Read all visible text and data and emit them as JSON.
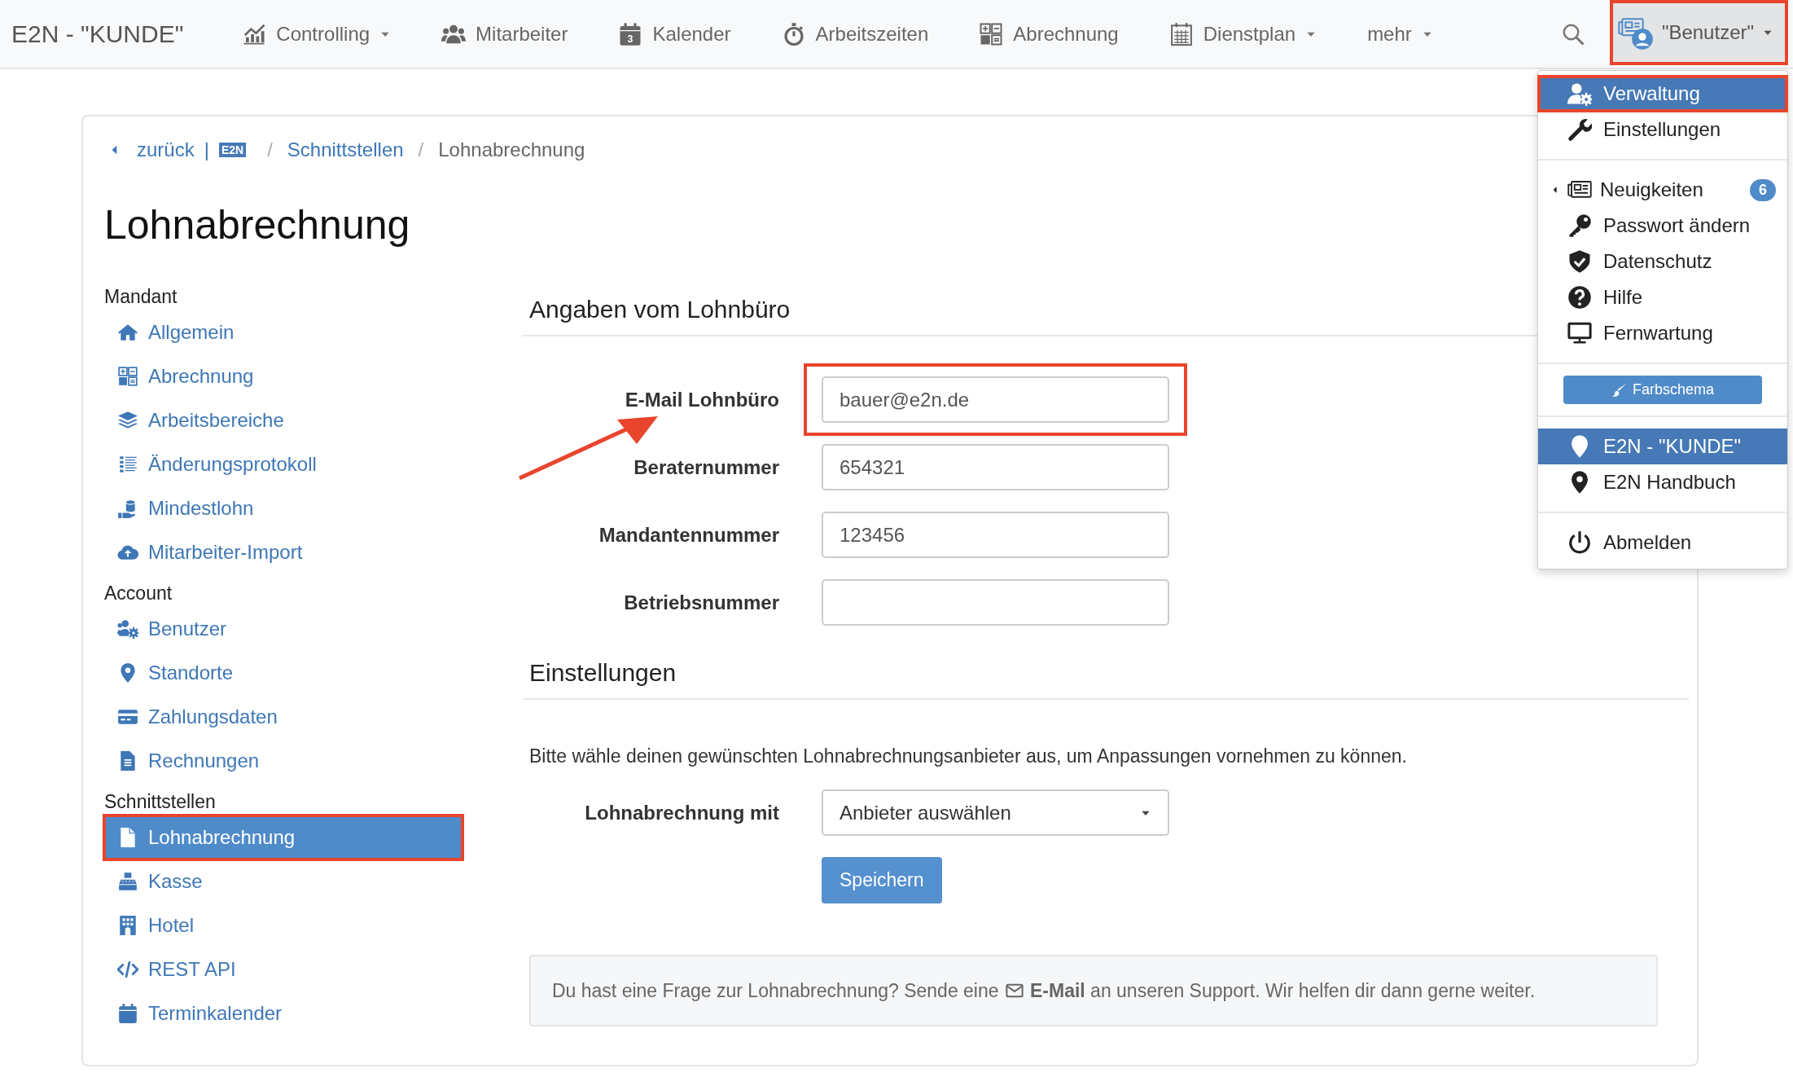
{
  "navbar": {
    "brand": "E2N - \"KUNDE\"",
    "items": [
      {
        "label": "Controlling",
        "dropdown": true
      },
      {
        "label": "Mitarbeiter",
        "dropdown": false
      },
      {
        "label": "Kalender",
        "dropdown": false,
        "icon_label": "3"
      },
      {
        "label": "Arbeitszeiten",
        "dropdown": false
      },
      {
        "label": "Abrechnung",
        "dropdown": false
      },
      {
        "label": "Dienstplan",
        "dropdown": true
      },
      {
        "label": "mehr",
        "dropdown": true
      }
    ],
    "user_menu": {
      "label": "\"Benutzer\"",
      "open": true,
      "highlighted": true
    }
  },
  "user_dropdown": {
    "groups": [
      {
        "items": [
          {
            "kind": "link",
            "label": "Verwaltung",
            "selected": true,
            "highlighted": true
          },
          {
            "kind": "link",
            "label": "Einstellungen",
            "selected": false,
            "highlighted": false
          }
        ]
      },
      {
        "items": [
          {
            "kind": "submenu",
            "label": "Neuigkeiten",
            "badge": "6",
            "selected": false,
            "highlighted": false
          },
          {
            "kind": "link",
            "label": "Passwort ändern",
            "selected": false,
            "highlighted": false
          },
          {
            "kind": "link",
            "label": "Datenschutz",
            "selected": false,
            "highlighted": false
          },
          {
            "kind": "link",
            "label": "Hilfe",
            "selected": false,
            "highlighted": false
          },
          {
            "kind": "link",
            "label": "Fernwartung",
            "selected": false,
            "highlighted": false
          }
        ]
      },
      {
        "items": [
          {
            "kind": "button",
            "label": "Farbschema"
          }
        ]
      },
      {
        "items": [
          {
            "kind": "link",
            "label": "E2N - \"KUNDE\"",
            "selected": true,
            "highlighted": false
          },
          {
            "kind": "link",
            "label": "E2N Handbuch",
            "selected": false,
            "highlighted": false
          }
        ]
      },
      {
        "items": [
          {
            "kind": "link",
            "label": "Abmelden",
            "selected": false,
            "highlighted": false
          }
        ]
      }
    ]
  },
  "breadcrumb": {
    "back": "zurück",
    "divider": "|",
    "logo": "E2N",
    "items": [
      {
        "separator": "/",
        "label": "Schnittstellen"
      },
      {
        "separator": "/",
        "label": "Lohnabrechnung"
      }
    ]
  },
  "page_title": "Lohnabrechnung",
  "sidebar": {
    "sections": [
      {
        "title": "Mandant",
        "items": [
          {
            "label": "Allgemein",
            "selected": false,
            "highlighted": false
          },
          {
            "label": "Abrechnung",
            "selected": false,
            "highlighted": false
          },
          {
            "label": "Arbeitsbereiche",
            "selected": false,
            "highlighted": false
          },
          {
            "label": "Änderungsprotokoll",
            "selected": false,
            "highlighted": false
          },
          {
            "label": "Mindestlohn",
            "selected": false,
            "highlighted": false
          },
          {
            "label": "Mitarbeiter-Import",
            "selected": false,
            "highlighted": false
          }
        ]
      },
      {
        "title": "Account",
        "items": [
          {
            "label": "Benutzer",
            "selected": false,
            "highlighted": false
          },
          {
            "label": "Standorte",
            "selected": false,
            "highlighted": false
          },
          {
            "label": "Zahlungsdaten",
            "selected": false,
            "highlighted": false
          },
          {
            "label": "Rechnungen",
            "selected": false,
            "highlighted": false
          }
        ]
      },
      {
        "title": "Schnittstellen",
        "items": [
          {
            "label": "Lohnabrechnung",
            "selected": true,
            "highlighted": true
          },
          {
            "label": "Kasse",
            "selected": false,
            "highlighted": false
          },
          {
            "label": "Hotel",
            "selected": false,
            "highlighted": false
          },
          {
            "label": "REST API",
            "selected": false,
            "highlighted": false
          },
          {
            "label": "Terminkalender",
            "selected": false,
            "highlighted": false
          }
        ]
      }
    ]
  },
  "payroll_office": {
    "title": "Angaben vom Lohnbüro",
    "fields": [
      {
        "label": "E-Mail Lohnbüro",
        "value": "bauer@e2n.de",
        "highlighted": true
      },
      {
        "label": "Beraternummer",
        "value": "654321",
        "highlighted": false
      },
      {
        "label": "Mandantennummer",
        "value": "123456",
        "highlighted": false
      },
      {
        "label": "Betriebsnummer",
        "highlighted": false
      }
    ]
  },
  "settings": {
    "title": "Einstellungen",
    "description": "Bitte wähle deinen gewünschten Lohnabrechnungsanbieter aus, um Anpassungen vornehmen zu können.",
    "select": {
      "label": "Lohnabrechnung mit",
      "value": "Anbieter auswählen"
    },
    "save_button": "Speichern"
  },
  "info": {
    "before": "Du hast eine Frage zur Lohnabrechnung? Sende eine",
    "link": "E-Mail",
    "after": "an unseren Support. Wir helfen dir dann gerne weiter."
  }
}
